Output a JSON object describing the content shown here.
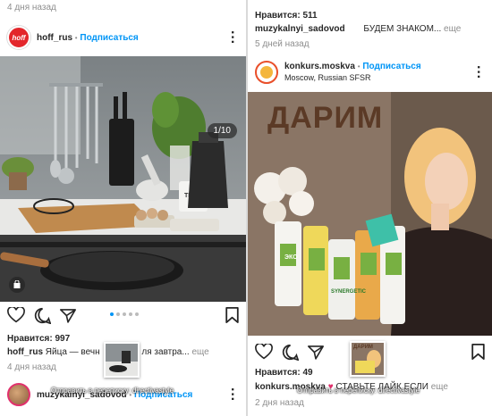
{
  "left_post": {
    "top_time": "4 дня назад",
    "username": "hoff_rus",
    "separator": "•",
    "follow": "Подписаться",
    "logo_text": "hoff",
    "carousel_counter": "1/10",
    "likes": "Нравится: 997",
    "caption_user": "hoff_rus",
    "caption_text": "Яйца — вечн",
    "caption_text_2": "ля завтра...",
    "more": "еще",
    "time": "4 дня назад",
    "teapot_text": "TEA"
  },
  "left_suggest": {
    "username": "muzykalnyi_sadovod",
    "separator": "•",
    "follow": "Подписаться"
  },
  "right_post": {
    "top_likes": "Нравится: 511",
    "top_caption_user": "muzykalnyi_sadovod",
    "top_caption_text": "БУДЕМ ЗНАКОМ...",
    "more": "еще",
    "top_time": "5 дней назад",
    "username": "konkurs.moskva",
    "separator": "•",
    "follow": "Подписаться",
    "location": "Moscow, Russian SFSR",
    "banner": "ДАРИМ",
    "product_text": "ЭКО",
    "product_brand": "SYNERGETIC",
    "likes": "Нравится: 49",
    "caption_user": "konkurs.moskva",
    "caption_text": "СТАВЬТЕ ЛАЙК ЕСЛИ",
    "caption_more": "еще",
    "time": "2 дня назад",
    "thumb_text": "ДАРИМ"
  },
  "toasts": {
    "left": "Отправить в переписку: directivastyle",
    "right": "Отправить в переписку: directivastyle"
  },
  "colors": {
    "hoff_red": "#e3262b",
    "link_blue": "#0095f6",
    "banner_brown": "#5b3a26"
  }
}
